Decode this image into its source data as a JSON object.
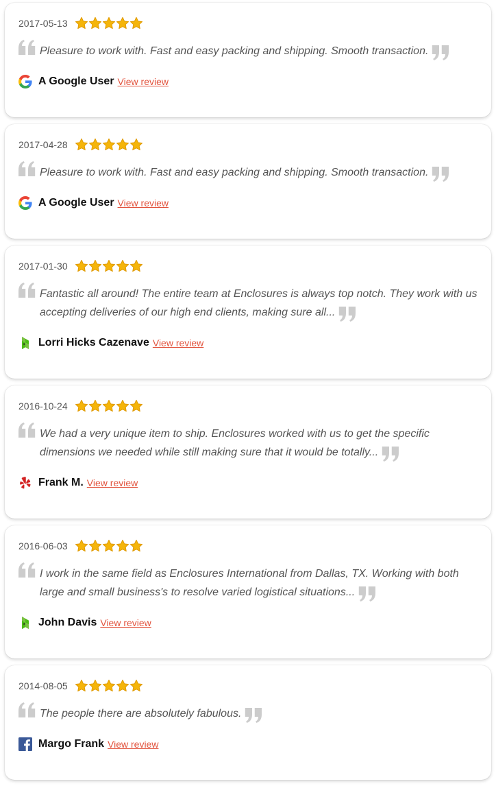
{
  "reviews": [
    {
      "date": "2017-05-13",
      "rating": 5,
      "text": "Pleasure to work with. Fast and easy packing and shipping. Smooth transaction.",
      "author": "A Google User",
      "source_icon": "google-icon",
      "link_label": "View review"
    },
    {
      "date": "2017-04-28",
      "rating": 5,
      "text": "Pleasure to work with. Fast and easy packing and shipping. Smooth transaction.",
      "author": "A Google User",
      "source_icon": "google-icon",
      "link_label": "View review"
    },
    {
      "date": "2017-01-30",
      "rating": 5,
      "text": "Fantastic all around! The entire team at Enclosures is always top notch. They work with us accepting deliveries of our high end clients, making sure all...",
      "author": "Lorri Hicks Cazenave",
      "source_icon": "houzz-icon",
      "link_label": "View review"
    },
    {
      "date": "2016-10-24",
      "rating": 5,
      "text": "We had a very unique item to ship. Enclosures worked with us to get the specific dimensions we needed while still making sure that it would be totally...",
      "author": "Frank M.",
      "source_icon": "yelp-icon",
      "link_label": "View review"
    },
    {
      "date": "2016-06-03",
      "rating": 5,
      "text": "I work in the same field as Enclosures International from Dallas, TX. Working with both large and small business's to resolve varied logistical situations...",
      "author": "John Davis",
      "source_icon": "houzz-icon",
      "link_label": "View review"
    },
    {
      "date": "2014-08-05",
      "rating": 5,
      "text": "The people there are absolutely fabulous.",
      "author": "Margo Frank",
      "source_icon": "facebook-icon",
      "link_label": "View review"
    }
  ],
  "colors": {
    "star": "#f5b50a",
    "star_outline": "#e09a00",
    "quote": "#cccccc",
    "link": "#e2533d"
  }
}
